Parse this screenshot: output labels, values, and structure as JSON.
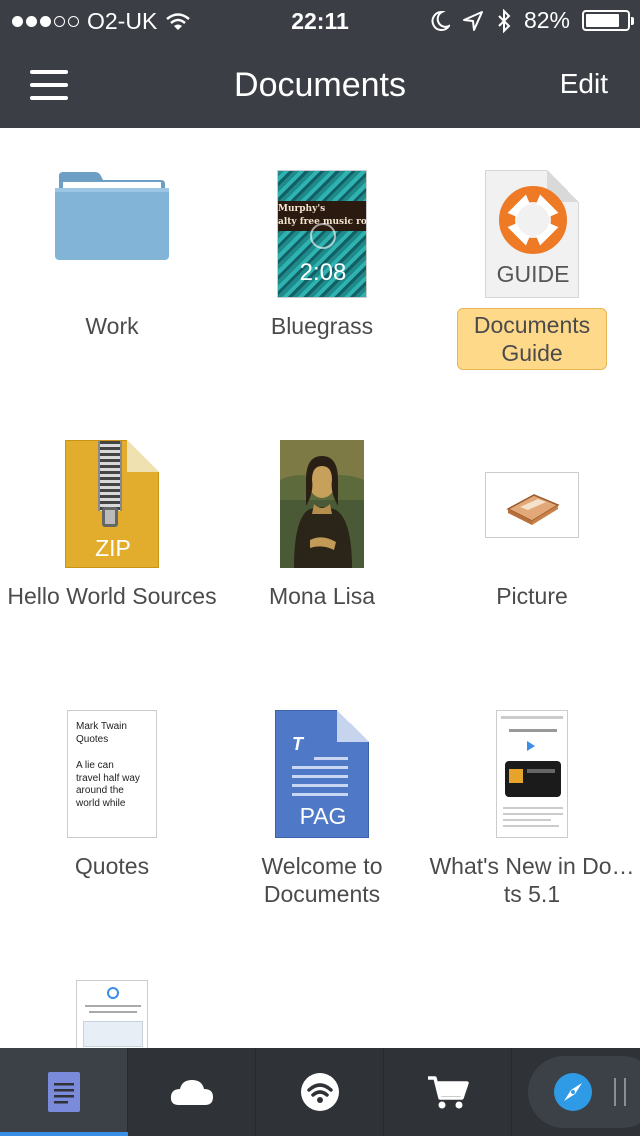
{
  "status_bar": {
    "carrier": "O2-UK",
    "time": "22:11",
    "battery_percent": "82%",
    "battery_level": 0.82,
    "signal_bars_filled": 3,
    "signal_bars_total": 5
  },
  "nav": {
    "title": "Documents",
    "edit_label": "Edit"
  },
  "items": [
    {
      "name": "Work",
      "type": "folder"
    },
    {
      "name": "Bluegrass",
      "type": "video",
      "duration": "2:08",
      "overlay_text": [
        "Murphy's",
        "alty free music room.c"
      ]
    },
    {
      "name": "Documents Guide",
      "type": "guide",
      "badge": "GUIDE",
      "selected": true
    },
    {
      "name": "Hello World Sources",
      "type": "zip",
      "badge": "ZIP"
    },
    {
      "name": "Mona Lisa",
      "type": "image"
    },
    {
      "name": "Picture",
      "type": "image"
    },
    {
      "name": "Quotes",
      "type": "text",
      "preview": [
        "Mark Twain",
        "Quotes",
        "",
        "A lie can",
        "travel half way",
        "around the",
        "world while"
      ]
    },
    {
      "name": "Welcome to Documents",
      "type": "pages",
      "badge": "PAG"
    },
    {
      "name": "What's New in Do…ts 5.1",
      "type": "web"
    },
    {
      "name": "",
      "type": "web"
    }
  ],
  "tabbar": {
    "tabs": [
      "documents",
      "cloud",
      "wifi",
      "store",
      "browser"
    ],
    "active": "documents"
  },
  "colors": {
    "nav_bg": "#3b3f45",
    "tabbar_bg": "#2f3237",
    "selection_bg": "#ffd98a",
    "accent_blue": "#3a8ee6",
    "folder_blue": "#7fb3d5",
    "zip_yellow": "#e2ac2d",
    "pages_blue": "#4f78c6"
  }
}
